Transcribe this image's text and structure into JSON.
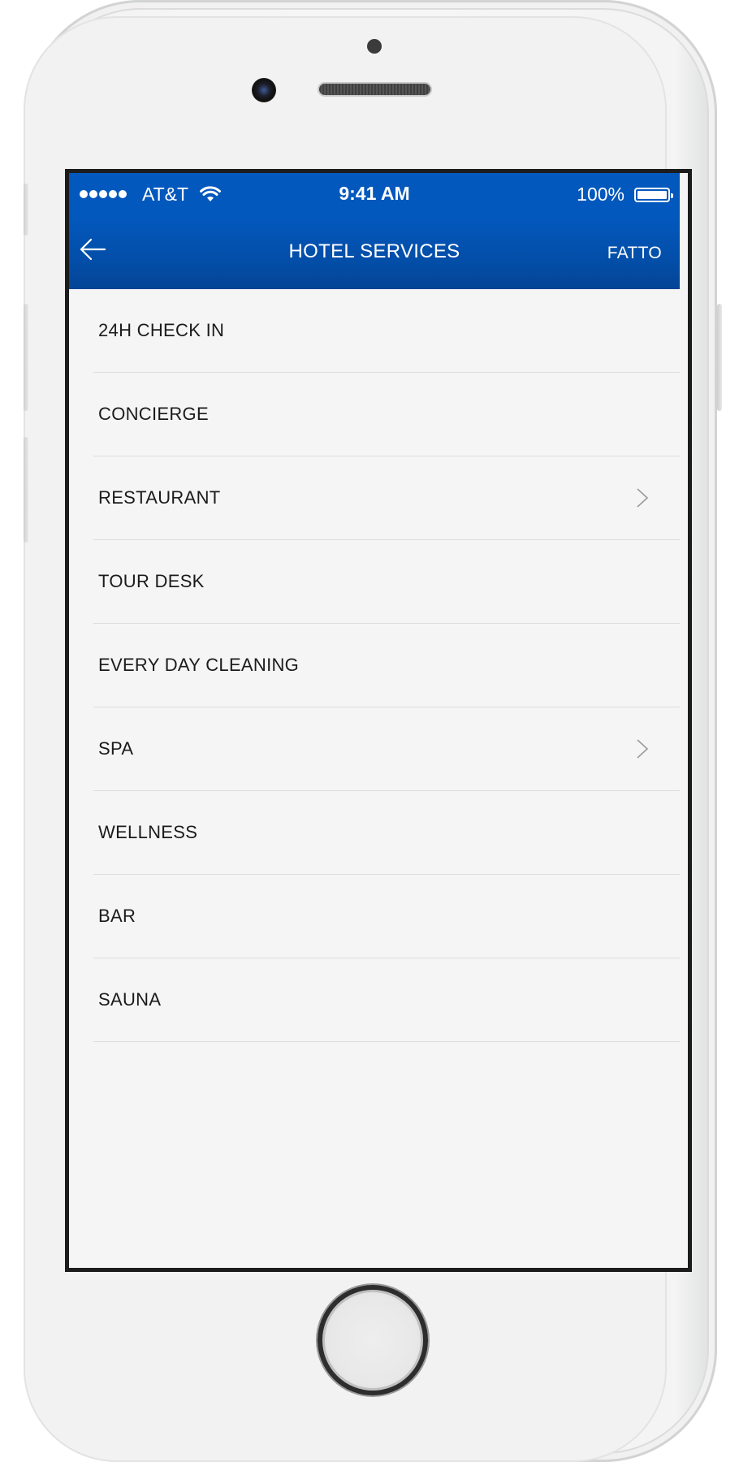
{
  "status_bar": {
    "carrier": "AT&T",
    "time": "9:41 AM",
    "battery": "100%",
    "signal_bars": 5,
    "battery_level": 1.0
  },
  "nav": {
    "title": "HOTEL SERVICES",
    "back_icon": "arrow-left-icon",
    "done_label": "FATTO"
  },
  "services": [
    {
      "label": "24H CHECK IN",
      "has_chevron": false
    },
    {
      "label": "CONCIERGE",
      "has_chevron": false
    },
    {
      "label": "RESTAURANT",
      "has_chevron": true
    },
    {
      "label": "TOUR DESK",
      "has_chevron": false
    },
    {
      "label": "EVERY DAY CLEANING",
      "has_chevron": false
    },
    {
      "label": "SPA",
      "has_chevron": true
    },
    {
      "label": "WELLNESS",
      "has_chevron": false
    },
    {
      "label": "BAR",
      "has_chevron": false
    },
    {
      "label": "SAUNA",
      "has_chevron": false
    }
  ],
  "colors": {
    "accent": "#0358bd",
    "background": "#f5f5f5",
    "text": "#1b1b1b",
    "divider": "#dddddd"
  }
}
